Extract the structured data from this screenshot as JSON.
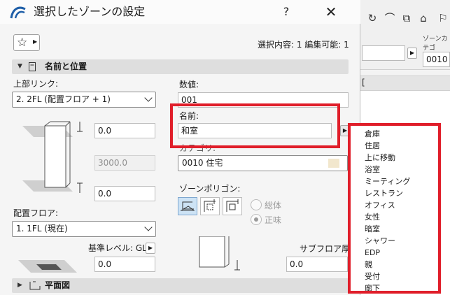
{
  "dialog": {
    "title": "選択したゾーンの設定",
    "help_label": "?",
    "close_label": "✕",
    "selection_info": "選択内容: 1 編集可能: 1"
  },
  "section_name_position": {
    "title": "名前と位置",
    "top_link_label": "上部リンク:",
    "top_link_value": "2. 2FL (配置フロア + 1)",
    "top_offset": "0.0",
    "height": "3000.0",
    "bottom_offset": "0.0",
    "home_floor_label": "配置フロア:",
    "home_floor_value": "1. 1FL (現在)",
    "ref_level_label": "基準レベル: GL",
    "ref_level_value": "0.0",
    "number_label": "数値:",
    "number_value": "001",
    "name_label": "名前:",
    "name_value": "和室",
    "category_label": "カテゴリ:",
    "category_value": "0010  住宅",
    "zone_polygon_label": "ゾーンポリゴン:",
    "radio_gross": "総体",
    "radio_net": "正味",
    "subfloor_label": "サブフロア厚さ",
    "subfloor_value": "0.0"
  },
  "section_floor_plan": {
    "title": "平面図"
  },
  "background_app": {
    "zone_category_label": "ゾーンカテゴ",
    "zone_category_value": "0010",
    "strip_text": "["
  },
  "name_suggestions": [
    "倉庫",
    "住居",
    "上に移動",
    "浴室",
    "ミーティング",
    "レストラン",
    "オフィス",
    "女性",
    "暗室",
    "シャワー",
    "EDP",
    "親",
    "受付",
    "廊下"
  ],
  "colors": {
    "annotation_red": "#e01e2a",
    "section_header": "#dedede",
    "active_button": "#cde3f5"
  }
}
